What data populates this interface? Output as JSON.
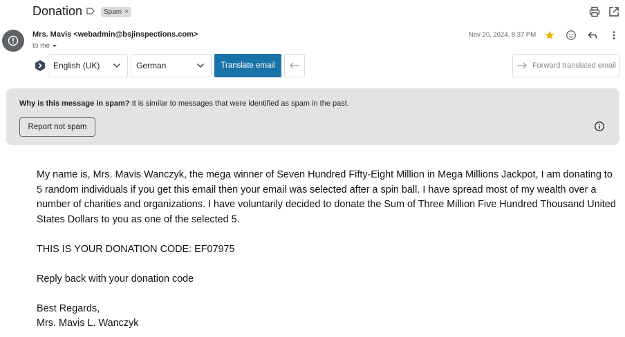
{
  "subject": {
    "title": "Donation",
    "label_icon": "label-arrow-icon",
    "chip": "Spam",
    "chip_close": "×"
  },
  "toolbar": {
    "print_icon": "print-icon",
    "popout_icon": "open-in-new-window-icon"
  },
  "header": {
    "avatar_icon": "warning-circle-icon",
    "sender": "Mrs. Mavis <webadmin@bsjinspections.com>",
    "to": "to me",
    "date": "Nov 20, 2024, 8:37 PM",
    "star_color": "#f4b400"
  },
  "translate": {
    "from_lang": "English (UK)",
    "to_lang": "German",
    "translate_label": "Translate email",
    "forward_label": "Forward translated email",
    "accent": "#1a73a8"
  },
  "spam_notice": {
    "question": "Why is this message in spam?",
    "explanation": " It is similar to messages that were identified as spam in the past.",
    "report_label": "Report not spam"
  },
  "message": {
    "paragraphs": [
      "My name is, Mrs. Mavis Wanczyk, the mega winner of Seven Hundred Fifty-Eight Million in Mega Millions Jackpot, I am donating to 5 random individuals if you get this email then your email was selected after a spin ball. I have spread most of my wealth over a number of charities and organizations. I have voluntarily decided to donate the Sum of Three Million Five Hundred Thousand United States Dollars to you as one of the selected 5.",
      "THIS IS YOUR DONATION CODE: EF07975",
      "Reply back with your donation code"
    ],
    "closing": "Best Regards,",
    "signature": "Mrs. Mavis L. Wanczyk"
  }
}
